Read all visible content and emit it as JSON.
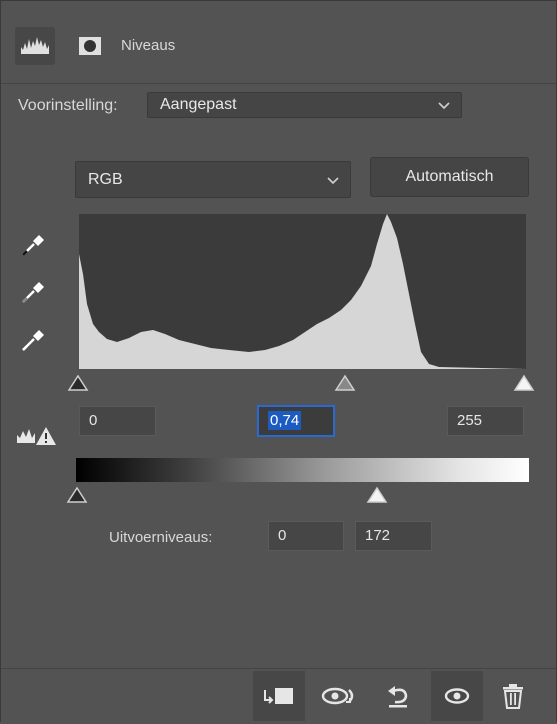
{
  "header": {
    "title": "Niveaus",
    "icons": [
      "levels-histogram-icon",
      "layer-mask-icon"
    ]
  },
  "preset": {
    "label": "Voorinstelling:",
    "value": "Aangepast"
  },
  "channel": {
    "value": "RGB"
  },
  "auto_button": {
    "label": "Automatisch"
  },
  "input_levels": {
    "black": "0",
    "gamma": "0,74",
    "white": "255"
  },
  "output_levels": {
    "label": "Uitvoerniveaus:",
    "black": "0",
    "white": "172"
  },
  "footer_icons": [
    "clip-to-layer-icon",
    "view-previous-icon",
    "reset-icon",
    "visibility-eye-icon",
    "trash-icon"
  ],
  "colors": {
    "panel": "#535353",
    "field": "#464646",
    "selection": "#1c5bc2",
    "histogram": "#d6d6d6"
  }
}
